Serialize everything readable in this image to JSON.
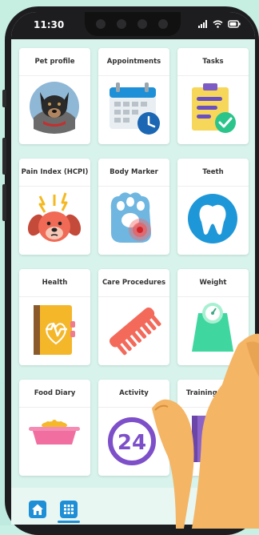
{
  "status": {
    "time": "11:30"
  },
  "tiles": [
    {
      "label": "Pet profile",
      "icon": "pet-photo-icon"
    },
    {
      "label": "Appointments",
      "icon": "calendar-clock-icon"
    },
    {
      "label": "Tasks",
      "icon": "clipboard-check-icon"
    },
    {
      "label": "Pain Index (HCPI)",
      "icon": "dog-pain-icon"
    },
    {
      "label": "Body Marker",
      "icon": "paw-marker-icon"
    },
    {
      "label": "Teeth",
      "icon": "tooth-icon"
    },
    {
      "label": "Health",
      "icon": "health-book-icon"
    },
    {
      "label": "Care Procedures",
      "icon": "comb-icon"
    },
    {
      "label": "Weight",
      "icon": "scale-icon"
    },
    {
      "label": "Food Diary",
      "icon": "food-bowl-icon"
    },
    {
      "label": "Activity",
      "icon": "activity-24-icon"
    },
    {
      "label": "Training Diary",
      "icon": "training-book-icon"
    }
  ],
  "bottom_nav": [
    {
      "icon": "home-icon"
    },
    {
      "icon": "grid-icon"
    }
  ],
  "colors": {
    "accent": "#1e8fd6",
    "background": "#c9f0e4"
  }
}
